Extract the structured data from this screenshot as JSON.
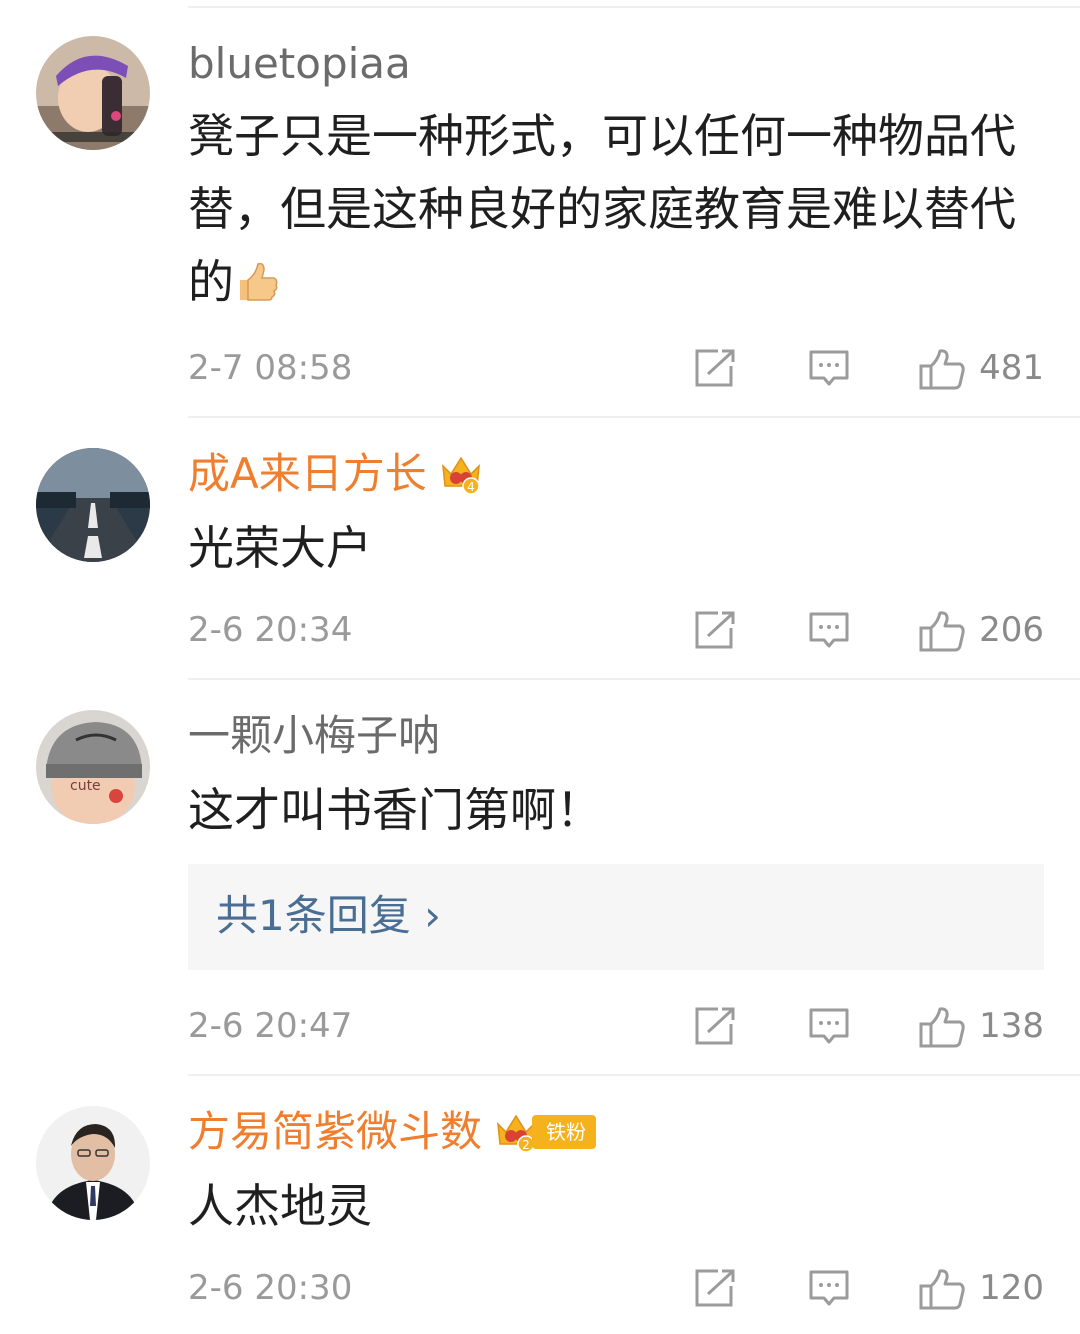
{
  "comments": [
    {
      "username": "bluetopiaa",
      "name_style": "plain",
      "text": "凳子只是一种形式，可以任何一种物品代替，但是这种良好的家庭教育是难以替代的",
      "emoji": "thumbs-up-emoji",
      "time": "2-7 08:58",
      "likes": "481",
      "avatar": "avatar-child-photo"
    },
    {
      "username": "成A来日方长",
      "name_style": "vip",
      "badge": "crown-badge-4",
      "text": "光荣大户",
      "time": "2-6 20:34",
      "likes": "206",
      "avatar": "avatar-road-photo"
    },
    {
      "username": "一颗小梅子呐",
      "name_style": "plain",
      "text": "这才叫书香门第啊！",
      "reply_link": "共1条回复 ›",
      "time": "2-6 20:47",
      "likes": "138",
      "avatar": "avatar-beanie-photo"
    },
    {
      "username": "方易简紫微斗数",
      "name_style": "vip",
      "badge": "crown-badge-2",
      "fan_tag": "铁粉",
      "text": "人杰地灵",
      "time": "2-6 20:30",
      "likes": "120",
      "avatar": "avatar-man-suit-photo"
    }
  ],
  "colors": {
    "vip_name": "#ef7f2f",
    "plain_name": "#6b6b6b",
    "link": "#4a6e93",
    "meta": "#9a9a9a",
    "badge_gold": "#f5b21d"
  }
}
